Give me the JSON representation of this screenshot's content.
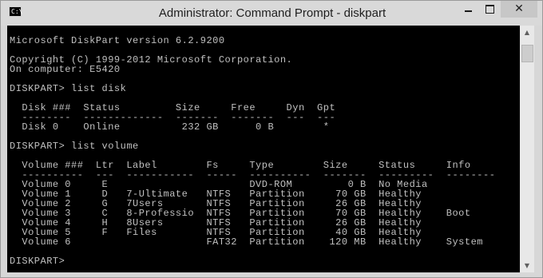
{
  "window": {
    "title": "Administrator: Command Prompt - diskpart",
    "icon_glyph": "C:\\",
    "buttons": {
      "minimize": "minimize-icon",
      "maximize": "maximize-icon",
      "close_glyph": "✕"
    }
  },
  "console": {
    "lines": [
      "",
      "Microsoft DiskPart version 6.2.9200",
      "",
      "Copyright (C) 1999-2012 Microsoft Corporation.",
      "On computer: E5420",
      "",
      "DISKPART> list disk",
      "",
      "  Disk ###  Status         Size     Free     Dyn  Gpt",
      "  --------  -------------  -------  -------  ---  ---",
      "  Disk 0    Online          232 GB      0 B        *",
      "",
      "DISKPART> list volume",
      "",
      "  Volume ###  Ltr  Label        Fs     Type        Size     Status     Info",
      "  ----------  ---  -----------  -----  ----------  -------  ---------  --------",
      "  Volume 0     E                       DVD-ROM         0 B  No Media",
      "  Volume 1     D   7-Ultimate   NTFS   Partition     70 GB  Healthy",
      "  Volume 2     G   7Users       NTFS   Partition     26 GB  Healthy",
      "  Volume 3     C   8-Professio  NTFS   Partition     70 GB  Healthy    Boot",
      "  Volume 4     H   8Users       NTFS   Partition     26 GB  Healthy",
      "  Volume 5     F   Files        NTFS   Partition     40 GB  Healthy",
      "  Volume 6                      FAT32  Partition    120 MB  Healthy    System",
      "",
      "DISKPART> "
    ]
  },
  "scrollbar": {
    "up_glyph": "▲",
    "down_glyph": "▼"
  }
}
